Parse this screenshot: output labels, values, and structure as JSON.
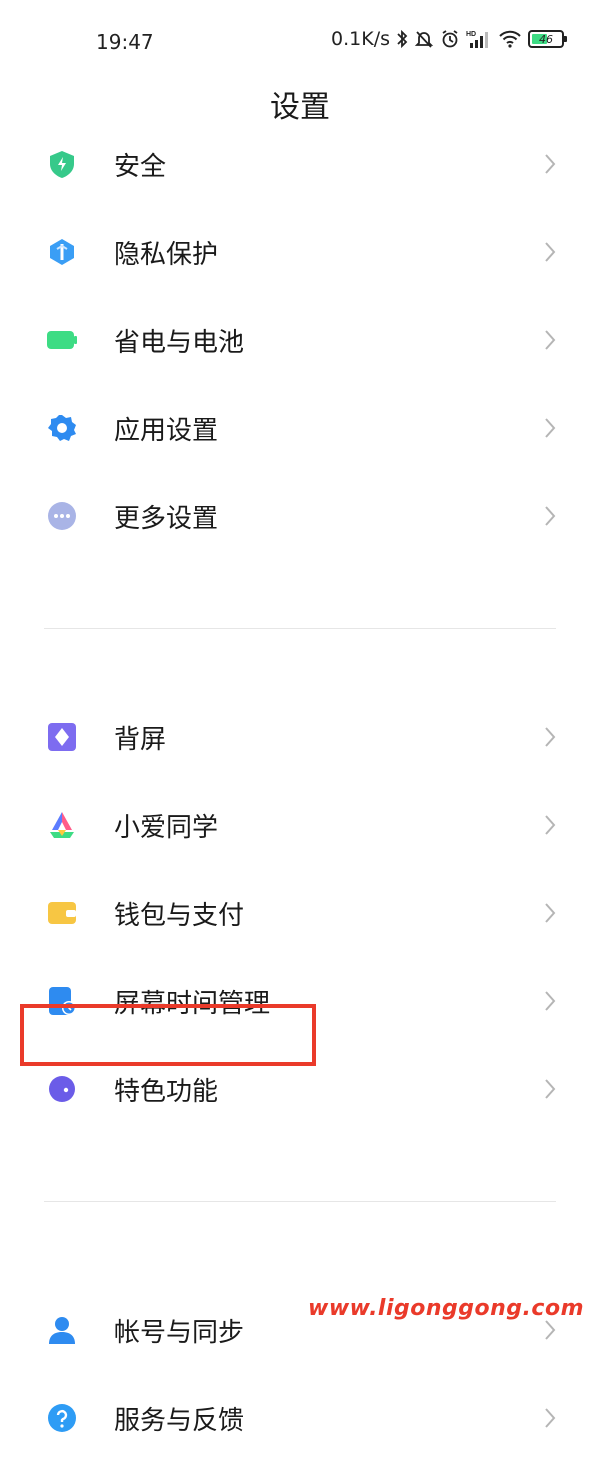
{
  "status_bar": {
    "time": "19:47",
    "net_speed": "0.1K/s",
    "battery_level": "46",
    "icons": [
      "bluetooth-icon",
      "mute-bell-icon",
      "alarm-icon",
      "hd-signal-icon",
      "wifi-icon",
      "battery-icon"
    ]
  },
  "header": {
    "title": "设置"
  },
  "groups": [
    {
      "items": [
        {
          "label": "安全",
          "icon": "shield-icon",
          "color": "#36c98a"
        },
        {
          "label": "隐私保护",
          "icon": "privacy-icon",
          "color": "#3a9ef5"
        },
        {
          "label": "省电与电池",
          "icon": "battery-green-icon",
          "color": "#3ddc84"
        },
        {
          "label": "应用设置",
          "icon": "gear-icon",
          "color": "#2e8bf0"
        },
        {
          "label": "更多设置",
          "icon": "more-dots-icon",
          "color": "#a9b4e6"
        }
      ]
    },
    {
      "items": [
        {
          "label": "背屏",
          "icon": "back-screen-icon",
          "color": "#7d6cf0"
        },
        {
          "label": "小爱同学",
          "icon": "xiaoai-icon",
          "color": "#ff5b8a"
        },
        {
          "label": "钱包与支付",
          "icon": "wallet-icon",
          "color": "#f7c643"
        },
        {
          "label": "屏幕时间管理",
          "icon": "screen-time-icon",
          "color": "#2e8bf0"
        },
        {
          "label": "特色功能",
          "icon": "features-icon",
          "color": "#6b5ce8"
        }
      ]
    },
    {
      "items": [
        {
          "label": "帐号与同步",
          "icon": "account-icon",
          "color": "#2e8bf0"
        },
        {
          "label": "服务与反馈",
          "icon": "help-icon",
          "color": "#2e9cf5"
        }
      ]
    }
  ],
  "watermark": "www.ligonggong.com",
  "highlight_color": "#ea3a2a"
}
